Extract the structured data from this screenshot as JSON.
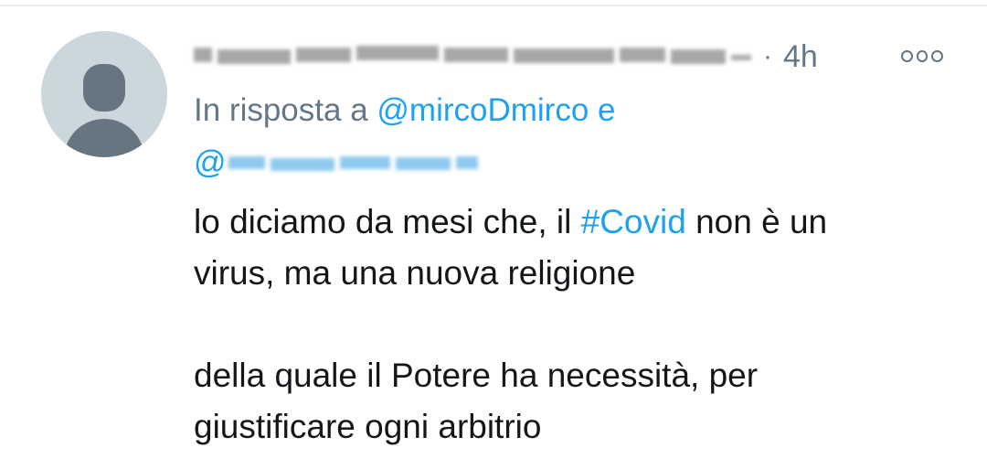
{
  "tweet": {
    "author_name": "",
    "time_separator": "·",
    "timestamp": "4h",
    "reply_prefix": "In risposta a",
    "reply_handle_1": "@mircoDmirco",
    "reply_conjunction": "e",
    "reply_handle_2_prefix": "@",
    "text_line1_before": "lo diciamo da mesi che, il",
    "hashtag": "#Covid",
    "text_line1_after": "non è un",
    "text_line2": "virus, ma una nuova religione",
    "text_line3": "della quale il Potere ha necessità, per",
    "text_line4": "giustificare ogni arbitrio"
  },
  "icons": {
    "avatar": "default-avatar-icon",
    "more": "more-options-icon"
  },
  "colors": {
    "link": "#1da1f2",
    "secondary_text": "#657786",
    "primary_text": "#14171a",
    "avatar_bg": "#ccd6dd"
  }
}
